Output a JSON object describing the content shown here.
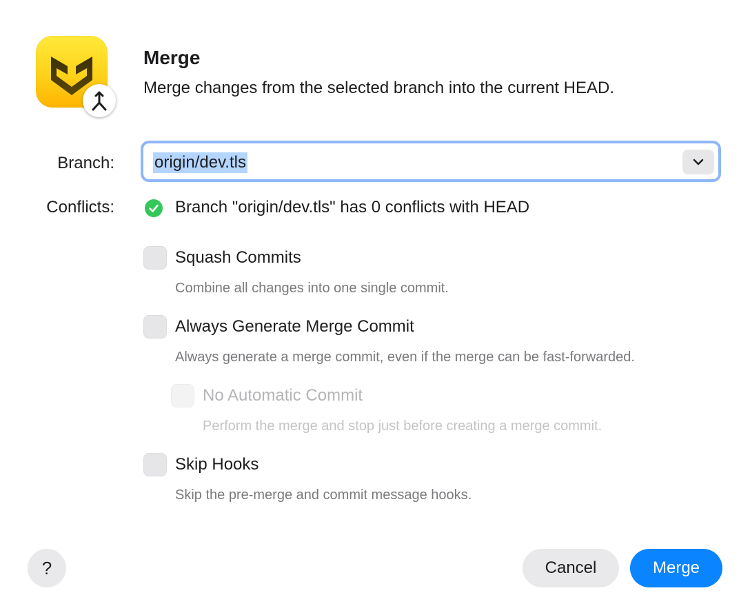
{
  "dialog": {
    "title": "Merge",
    "subtitle": "Merge changes from the selected branch into the current HEAD.",
    "app_icon": "fork-app-icon",
    "badge_icon": "merge-icon"
  },
  "branch": {
    "label": "Branch:",
    "value": "origin/dev.tls",
    "dropdown_icon": "chevron-down-icon"
  },
  "conflicts": {
    "label": "Conflicts:",
    "status_icon": "check-circle-icon",
    "status_color": "#34c759",
    "text": "Branch \"origin/dev.tls\" has 0 conflicts with HEAD"
  },
  "options": {
    "squash": {
      "title": "Squash Commits",
      "description": "Combine all changes into one single commit.",
      "checked": false
    },
    "always_merge_commit": {
      "title": "Always Generate Merge Commit",
      "description": "Always generate a merge commit, even if the merge can be fast-forwarded.",
      "checked": false
    },
    "no_auto_commit": {
      "title": "No Automatic Commit",
      "description": "Perform the merge and stop just before creating a merge commit.",
      "checked": false,
      "disabled": true
    },
    "skip_hooks": {
      "title": "Skip Hooks",
      "description": "Skip the pre-merge and commit message hooks.",
      "checked": false
    }
  },
  "footer": {
    "help_label": "?",
    "cancel_label": "Cancel",
    "merge_label": "Merge",
    "accent_color": "#0a84ff"
  }
}
